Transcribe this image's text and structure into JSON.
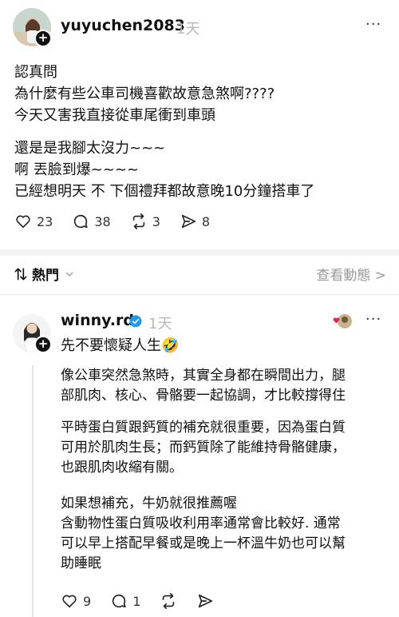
{
  "post": {
    "username": "yuyuchen2083",
    "time": "1天",
    "more": "···",
    "lines": [
      "認真問",
      "為什麼有些公車司機喜歡故意急煞啊????",
      "今天又害我直接從車尾衝到車頭",
      "還是是我腳太沒力~~~",
      "啊 丟臉到爆~~~~",
      "已經想明天 不 下個禮拜都故意晚10分鐘搭車了"
    ],
    "likes": "23",
    "comments": "38",
    "reposts": "3",
    "shares": "8"
  },
  "sort": {
    "label": "熱門",
    "view_activity": "查看動態 >"
  },
  "reply": {
    "username": "winny.rd",
    "time": "1天",
    "more": "···",
    "first_line": "先不要懷疑人生🤣",
    "paragraphs": [
      [
        "像公車突然急煞時，其實全身都在瞬間出力，腿",
        "部肌肉、核心、骨骼要一起協調，才比較撐得住"
      ],
      [
        "平時蛋白質跟鈣質的補充就很重要，因為蛋白質",
        "可用於肌肉生長；而鈣質除了能維持骨骼健康，",
        "也跟肌肉收縮有關。"
      ],
      [
        "如果想補充，牛奶就很推薦喔",
        "含動物性蛋白質吸收利用率通常會比較好. 通常",
        "可以早上搭配早餐或是晚上一杯溫牛奶也可以幫",
        "助睡眠"
      ]
    ],
    "likes": "9",
    "comments": "1"
  },
  "colors": {
    "verified": "#1d9bf0",
    "heart_badge": "#e0245e"
  }
}
